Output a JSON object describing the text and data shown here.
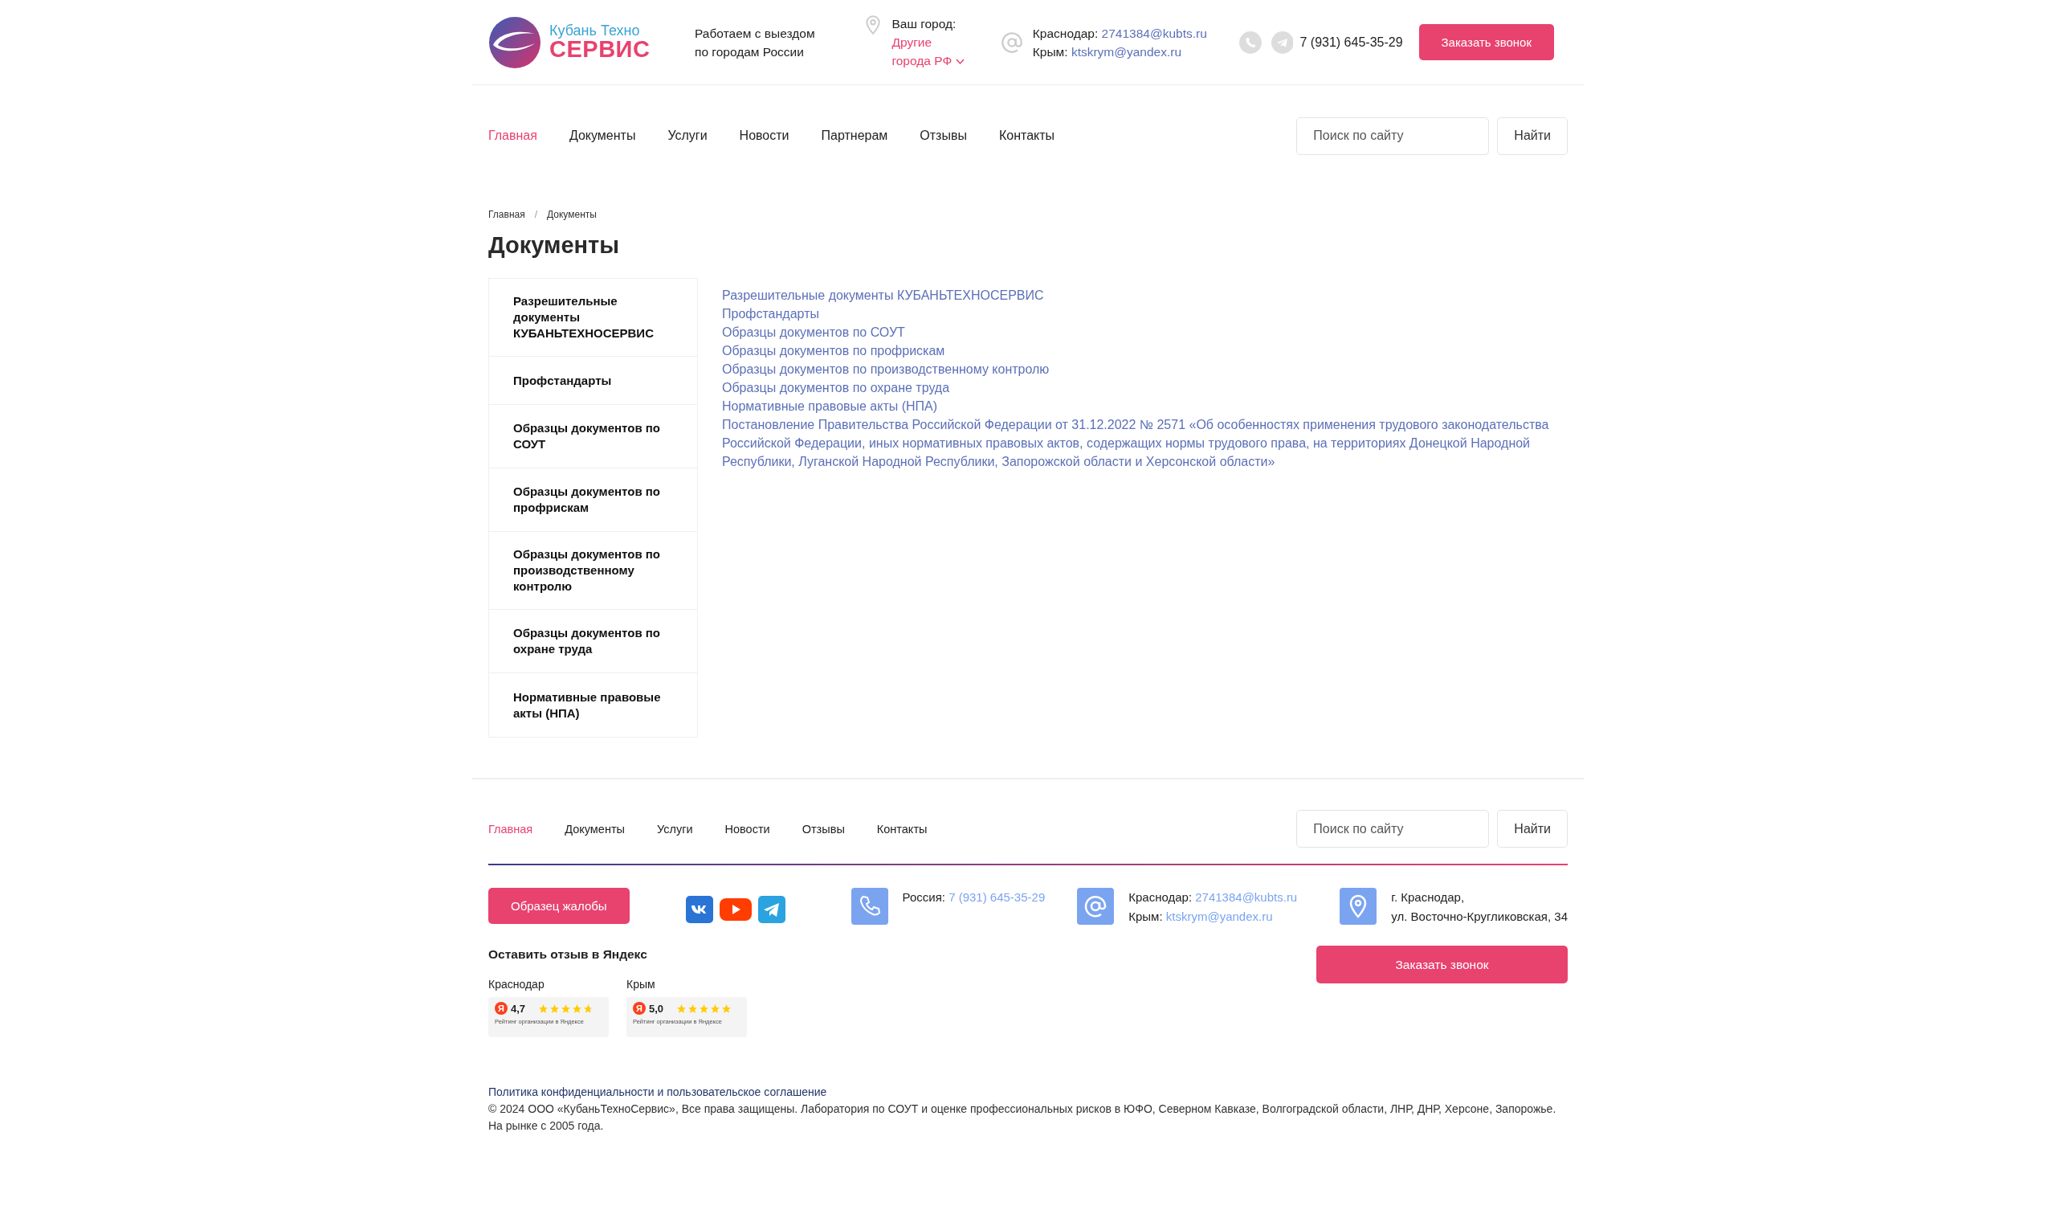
{
  "header": {
    "logo": {
      "line1": "Кубань Техно",
      "line2": "СЕРВИС"
    },
    "tagline": "Работаем с выездом по городам России",
    "city": {
      "label": "Ваш город:",
      "value": "Другие города РФ"
    },
    "emails": [
      {
        "label": "Краснодар:",
        "email": "2741384@kubts.ru"
      },
      {
        "label": "Крым:",
        "email": "ktskrym@yandex.ru"
      }
    ],
    "phone": "7 (931) 645-35-29",
    "callback_button": "Заказать звонок"
  },
  "nav": {
    "items": [
      {
        "label": "Главная",
        "selected": true
      },
      {
        "label": "Документы",
        "selected": false
      },
      {
        "label": "Услуги",
        "selected": false
      },
      {
        "label": "Новости",
        "selected": false
      },
      {
        "label": "Партнерам",
        "selected": false
      },
      {
        "label": "Отзывы",
        "selected": false
      },
      {
        "label": "Контакты",
        "selected": false
      }
    ],
    "search": {
      "placeholder": "Поиск по сайту",
      "button": "Найти"
    }
  },
  "breadcrumbs": [
    "Главная",
    "Документы"
  ],
  "breadcrumb_separator": "/",
  "title": "Документы",
  "sidebar": {
    "items": [
      "Разрешительные документы КУБАНЬТЕХНОСЕРВИС",
      "Профстандарты",
      "Образцы документов по СОУТ",
      "Образцы документов по профрискам",
      "Образцы документов по производственному контролю",
      "Образцы документов по охране труда",
      "Нормативные правовые акты (НПА)"
    ]
  },
  "links": [
    "Разрешительные документы КУБАНЬТЕХНОСЕРВИС",
    "Профстандарты",
    "Образцы документов по СОУТ",
    "Образцы документов по профрискам",
    "Образцы документов по производственному контролю",
    "Образцы документов по охране труда",
    "Нормативные правовые акты (НПА)",
    "Постановление Правительства Российской Федерации от 31.12.2022 № 2571 «Об особенностях применения трудового законодательства Российской Федерации, иных нормативных правовых актов, содержащих нормы трудового права, на территориях Донецкой Народной Республики, Луганской Народной Республики, Запорожской области и Херсонской области»"
  ],
  "footer": {
    "nav": {
      "items": [
        {
          "label": "Главная",
          "selected": true
        },
        {
          "label": "Документы",
          "selected": false
        },
        {
          "label": "Услуги",
          "selected": false
        },
        {
          "label": "Новости",
          "selected": false
        },
        {
          "label": "Отзывы",
          "selected": false
        },
        {
          "label": "Контакты",
          "selected": false
        }
      ],
      "search": {
        "placeholder": "Поиск по сайту",
        "button": "Найти"
      }
    },
    "complaint_button": "Образец жалобы",
    "phone": {
      "label": "Россия:",
      "value": "7 (931) 645-35-29"
    },
    "emails": [
      {
        "label": "Краснодар:",
        "email": "2741384@kubts.ru"
      },
      {
        "label": "Крым:",
        "email": "ktskrym@yandex.ru"
      }
    ],
    "address": [
      "г. Краснодар,",
      "ул. Восточно-Кругликовская, 34"
    ],
    "callback_button": "Заказать звонок",
    "reviews": {
      "heading": "Оставить отзыв в Яндекс",
      "items": [
        {
          "city": "Краснодар",
          "logo_letter": "Я",
          "score": "4,7",
          "stars": 4.7,
          "caption": "Рейтинг организации в Яндексе"
        },
        {
          "city": "Крым",
          "logo_letter": "Я",
          "score": "5,0",
          "stars": 5,
          "caption": "Рейтинг организации в Яндексе"
        }
      ]
    },
    "policy_link": "Политика конфиденциальности и пользовательское соглашение",
    "copyright": "© 2024 ООО «КубаньТехноСервис», Все права защищены. Лаборатория по СОУТ и оценке профессиональных рисков в ЮФО, Северном Кавказе, Волгоградской области, ЛНР, ДНР, Херсоне, Запорожье. На рынке с 2005 года."
  }
}
